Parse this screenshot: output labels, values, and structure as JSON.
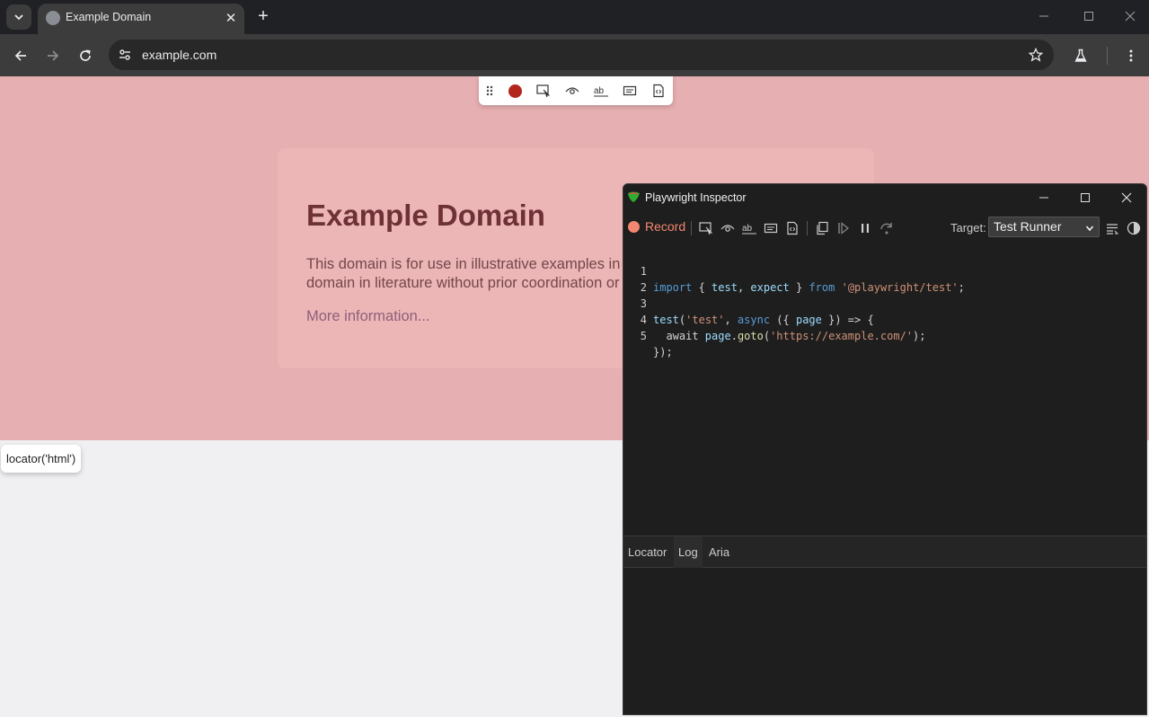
{
  "browser": {
    "tab_title": "Example Domain",
    "url": "example.com"
  },
  "page": {
    "heading": "Example Domain",
    "paragraph": "This domain is for use in illustrative examples in documents. You may use this domain in literature without prior coordination or asking for permission.",
    "link": "More information..."
  },
  "recorder": {
    "locator_tooltip": "locator('html')"
  },
  "inspector": {
    "title": "Playwright Inspector",
    "record_label": "Record",
    "target_label": "Target:",
    "target_value": "Test Runner",
    "code": {
      "line1": {
        "n": "1",
        "parts": [
          "import",
          " { ",
          "test",
          ", ",
          "expect",
          " } ",
          "from",
          " ",
          "'@playwright/test'",
          ";"
        ]
      },
      "line2": {
        "n": "2"
      },
      "line3": {
        "n": "3",
        "parts": [
          "test",
          "(",
          "'test'",
          ", ",
          "async",
          " ({ ",
          "page",
          " }) => {"
        ]
      },
      "line4": {
        "n": "4",
        "parts": [
          "  await ",
          "page",
          ".",
          "goto",
          "(",
          "'https://example.com/'",
          ");"
        ]
      },
      "line5": {
        "n": "5",
        "parts": [
          "});"
        ]
      }
    },
    "tabs": {
      "locator": "Locator",
      "log": "Log",
      "aria": "Aria"
    }
  },
  "colors": {
    "highlight": "#e6afb1",
    "record": "#f48771",
    "recorder_dot": "#b3261e"
  }
}
